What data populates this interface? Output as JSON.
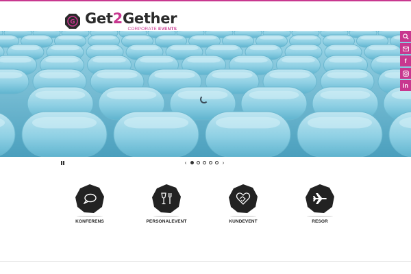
{
  "brand": {
    "name_pre": "Get",
    "name_num": "2",
    "name_post": "Gether",
    "tagline_pre": "CORPORATE",
    "tagline_bold": "EVENTS",
    "accent_color": "#c8378f"
  },
  "social": [
    {
      "name": "search-icon"
    },
    {
      "name": "mail-icon"
    },
    {
      "name": "facebook-icon",
      "glyph": "f"
    },
    {
      "name": "instagram-icon"
    },
    {
      "name": "linkedin-icon",
      "glyph": "in"
    }
  ],
  "slider": {
    "slides": 5,
    "active": 1,
    "prev": "‹",
    "next": "›"
  },
  "services": [
    {
      "label": "KONFERENS",
      "icon": "speech-bubble-icon"
    },
    {
      "label": "PERSONALEVENT",
      "icon": "glass-fork-icon"
    },
    {
      "label": "KUNDEVENT",
      "icon": "handshake-heart-icon"
    },
    {
      "label": "RESOR",
      "icon": "airplane-icon"
    }
  ]
}
